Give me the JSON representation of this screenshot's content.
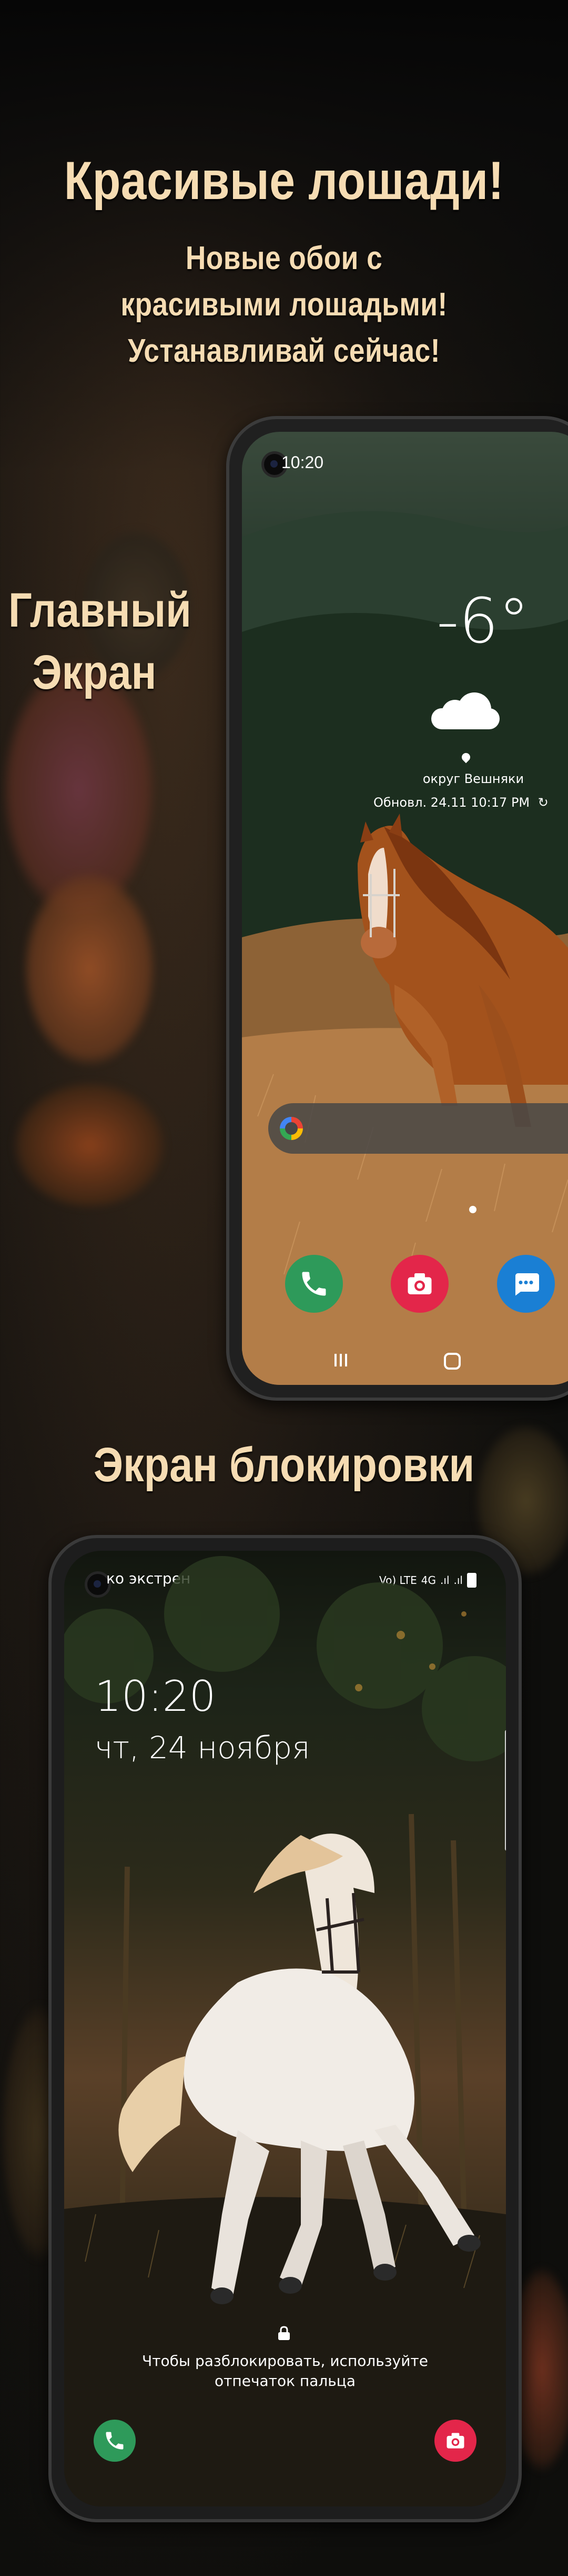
{
  "promo": {
    "title": "Красивые лошади!",
    "subtitle_lines": [
      "Новые обои с",
      "красивыми лошадьми!",
      "Устанавливай сейчас!"
    ],
    "home_label_lines": [
      "Главный",
      "Экран"
    ],
    "lock_label": "Экран блокировки"
  },
  "home_screen": {
    "status_time": "10:20",
    "weather": {
      "temperature": "-6°",
      "location": "округ Вешняки",
      "updated": "Обновл. 24.11 10:17 PM"
    },
    "icons": [
      "google-search-icon",
      "phone-icon",
      "camera-icon",
      "messages-icon"
    ]
  },
  "lock_screen": {
    "carrier": "ко экстрен",
    "status_icons": [
      "Vo) LTE",
      "4G",
      ".ıl",
      ".ıl",
      "battery"
    ],
    "time": "10:20",
    "date": "чт, 24 ноября",
    "unlock_hint_lines": [
      "Чтобы разблокировать, используйте",
      "отпечаток пальца"
    ]
  },
  "colors": {
    "heading": "#f6dcb3",
    "phone_app_green": "#2e9a5a",
    "camera_app_red": "#e3264a",
    "messages_app_blue": "#1a7fd4"
  }
}
